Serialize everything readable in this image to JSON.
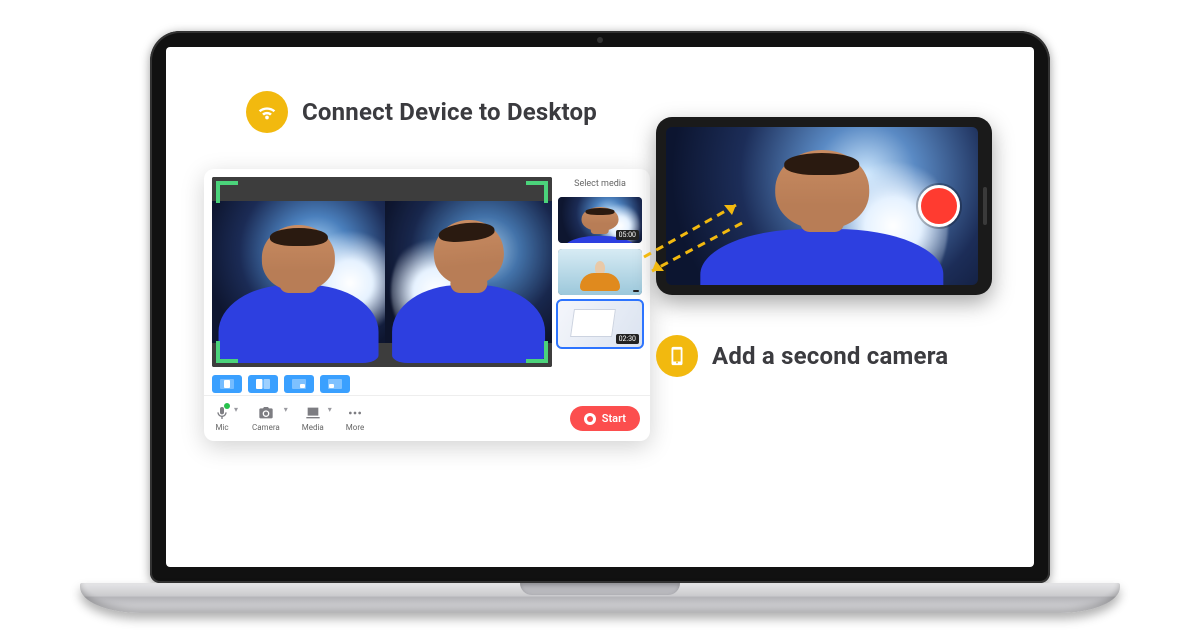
{
  "features": {
    "connect": {
      "label": "Connect Device to Desktop"
    },
    "camera": {
      "label": "Add a second camera"
    }
  },
  "app": {
    "mediaPanel": {
      "header": "Select media",
      "thumbs": [
        {
          "duration": "05:00"
        },
        {
          "duration": ""
        },
        {
          "duration": "02:30"
        }
      ]
    },
    "toolbar": {
      "mic": "Mic",
      "camera": "Camera",
      "media": "Media",
      "more": "More",
      "start": "Start"
    }
  }
}
